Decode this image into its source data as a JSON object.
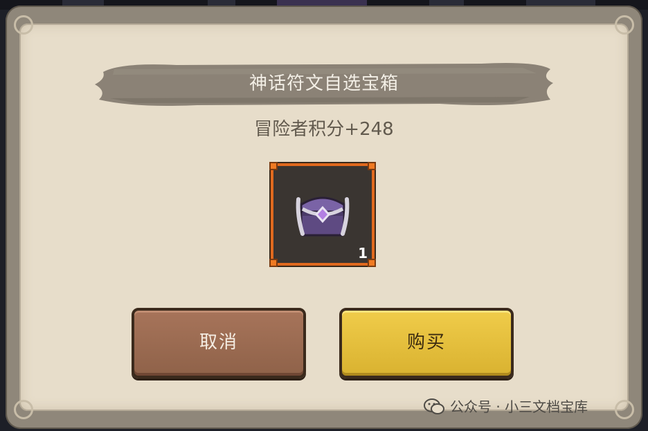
{
  "dialog": {
    "title": "神话符文自选宝箱",
    "subtitle": "冒险者积分+248"
  },
  "item": {
    "icon": "purple-treasure-chest",
    "count": "1",
    "frame_color": "#e0691e"
  },
  "buttons": {
    "cancel_label": "取消",
    "buy_label": "购买"
  },
  "watermark": {
    "text": "公众号 · 小三文档宝库",
    "icon": "wechat-icon"
  },
  "colors": {
    "parchment": "#e7ddca",
    "banner": "#8b8276",
    "cancel": "#9a6a50",
    "buy": "#e6c03c"
  }
}
